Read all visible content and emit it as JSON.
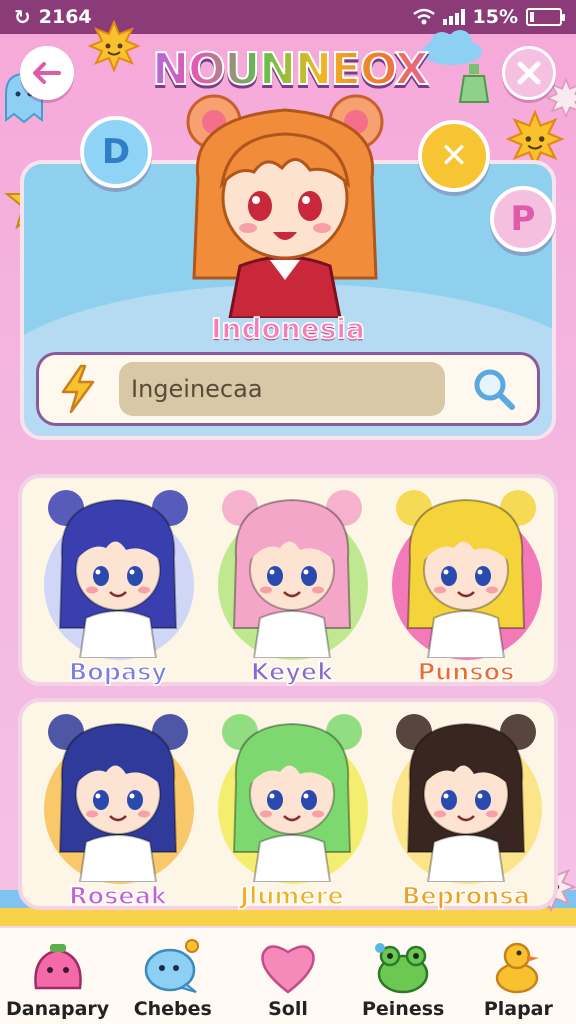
{
  "status_bar": {
    "time": "2164",
    "battery": "15%",
    "battery_level": 0.15
  },
  "header": {
    "title": "NOUNNEOX"
  },
  "bubbles": {
    "left": "D",
    "right": "✕",
    "bottom": "P"
  },
  "hero": {
    "label": "Indonesia"
  },
  "search": {
    "value": "Ingeinecaa"
  },
  "characters_row1": [
    {
      "name": "Bopasy",
      "color": "#7a7fe0",
      "disc": "#cfd6f6",
      "hair": "#3a3fb0"
    },
    {
      "name": "Keyek",
      "color": "#8a6ad0",
      "disc": "#bfe890",
      "hair": "#f4a6c8"
    },
    {
      "name": "Punsos",
      "color": "#f06a2a",
      "disc": "#f27ab8",
      "hair": "#f4d43a"
    }
  ],
  "characters_row2": [
    {
      "name": "Roseak",
      "color": "#c060d8",
      "disc": "#f8c86a",
      "hair": "#2f3a9a"
    },
    {
      "name": "Jlumere",
      "color": "#f0b020",
      "disc": "#f4ee70",
      "hair": "#7ed870"
    },
    {
      "name": "Bepronsa",
      "color": "#f0a020",
      "disc": "#fbe48a",
      "hair": "#3a2620"
    }
  ],
  "bottom_nav": [
    {
      "label": "Danapary",
      "icon": "pink-blob-icon"
    },
    {
      "label": "Chebes",
      "icon": "blue-ghost-icon"
    },
    {
      "label": "Soll",
      "icon": "heart-icon"
    },
    {
      "label": "Peiness",
      "icon": "green-frog-icon"
    },
    {
      "label": "Plapar",
      "icon": "yellow-duck-icon"
    }
  ]
}
